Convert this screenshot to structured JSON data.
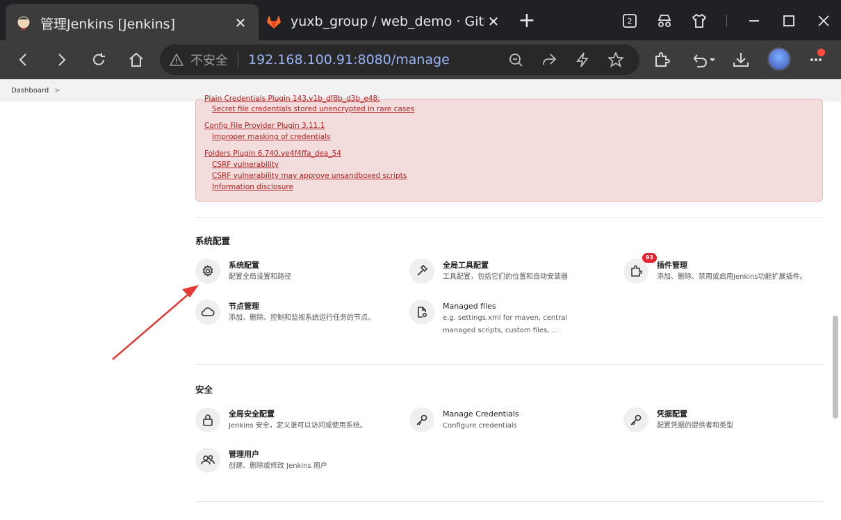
{
  "browser": {
    "tabs": [
      {
        "title": "管理Jenkins [Jenkins]",
        "active": true
      },
      {
        "title": "yuxb_group / web_demo · GitLab",
        "active": false
      }
    ],
    "tab_count": "2",
    "security_label": "不安全",
    "url": "192.168.100.91:8080/manage"
  },
  "breadcrumb": {
    "root": "Dashboard",
    "chevron": ">"
  },
  "warnings": {
    "cut_line": "Plain Credentials Plugin 143.v1b_df8b_d3b_e48:",
    "items": [
      {
        "sub": [
          "Secret file credentials stored unencrypted in rare cases"
        ]
      },
      {
        "plugin": "Config File Provider Plugin 3.11.1",
        "sub": [
          "Improper masking of credentials"
        ]
      },
      {
        "plugin": "Folders Plugin 6.740.ve4f4ffa_dea_54",
        "sub": [
          "CSRF vulnerability",
          "CSRF vulnerability may approve unsandboxed scripts",
          "Information disclosure"
        ]
      }
    ]
  },
  "sections": {
    "system": {
      "title": "系统配置",
      "items": [
        {
          "title": "系统配置",
          "desc": "配置全局设置和路径",
          "icon": "gear-icon"
        },
        {
          "title": "全局工具配置",
          "desc": "工具配置，包括它们的位置和自动安装器",
          "icon": "hammer-icon"
        },
        {
          "title": "插件管理",
          "desc": "添加、删除、禁用或启用Jenkins功能扩展插件。",
          "icon": "puzzle-icon",
          "badge": "93"
        },
        {
          "title": "节点管理",
          "desc": "添加、删除、控制和监视系统运行任务的节点。",
          "icon": "cloud-icon"
        },
        {
          "title": "Managed files",
          "desc": "e.g. settings.xml for maven, central managed scripts, custom files, ...",
          "icon": "file-gear-icon"
        }
      ]
    },
    "security": {
      "title": "安全",
      "items": [
        {
          "title": "全局安全配置",
          "desc": "Jenkins 安全，定义谁可以访问或使用系统。",
          "icon": "lock-icon"
        },
        {
          "title": "Manage Credentials",
          "desc": "Configure credentials",
          "icon": "key-icon"
        },
        {
          "title": "凭据配置",
          "desc": "配置凭据的提供者和类型",
          "icon": "key-icon"
        },
        {
          "title": "管理用户",
          "desc": "创建、删除或修改 Jenkins 用户",
          "icon": "users-icon"
        }
      ]
    }
  },
  "colors": {
    "accent_red": "#e8212f",
    "warning_bg": "#f2dcdc",
    "annotation_arrow": "#e53935"
  }
}
